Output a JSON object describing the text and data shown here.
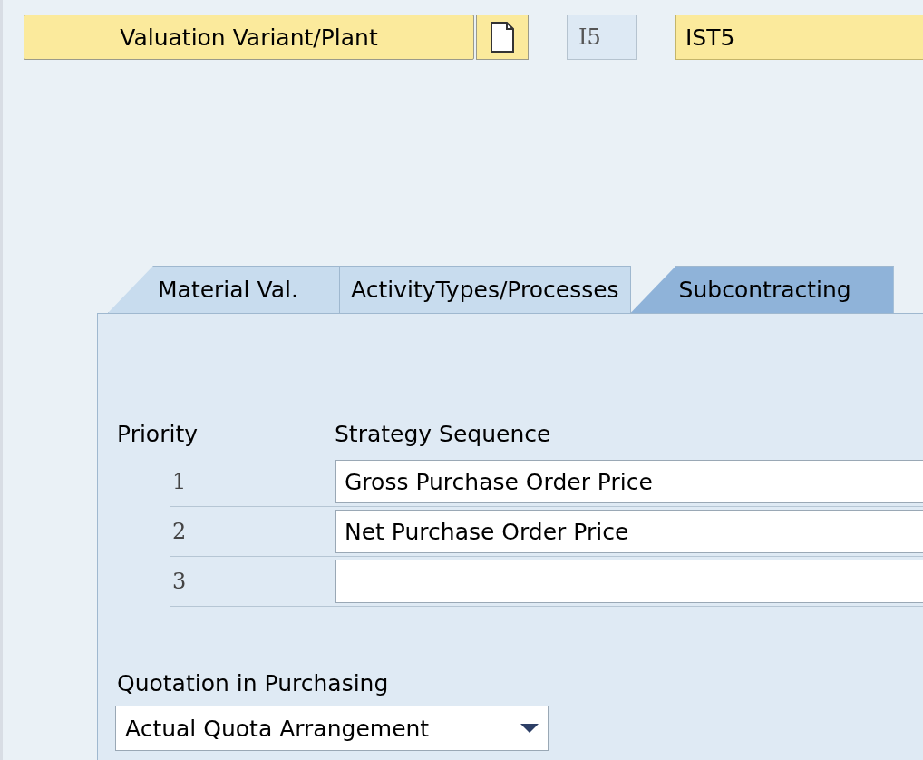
{
  "header": {
    "button": "Valuation Variant/Plant",
    "code": "I5",
    "value": "IST5"
  },
  "tabs": [
    {
      "label": "Material Val.",
      "selected": false
    },
    {
      "label": "ActivityTypes/Processes",
      "selected": false
    },
    {
      "label": "Subcontracting",
      "selected": true
    }
  ],
  "strategy": {
    "priority_heading": "Priority",
    "sequence_heading": "Strategy Sequence",
    "rows": [
      {
        "priority": "1",
        "strategy": "Gross Purchase Order Price"
      },
      {
        "priority": "2",
        "strategy": "Net Purchase Order Price"
      },
      {
        "priority": "3",
        "strategy": ""
      }
    ]
  },
  "quotation": {
    "label": "Quotation in Purchasing",
    "value": "Actual Quota Arrangement"
  }
}
